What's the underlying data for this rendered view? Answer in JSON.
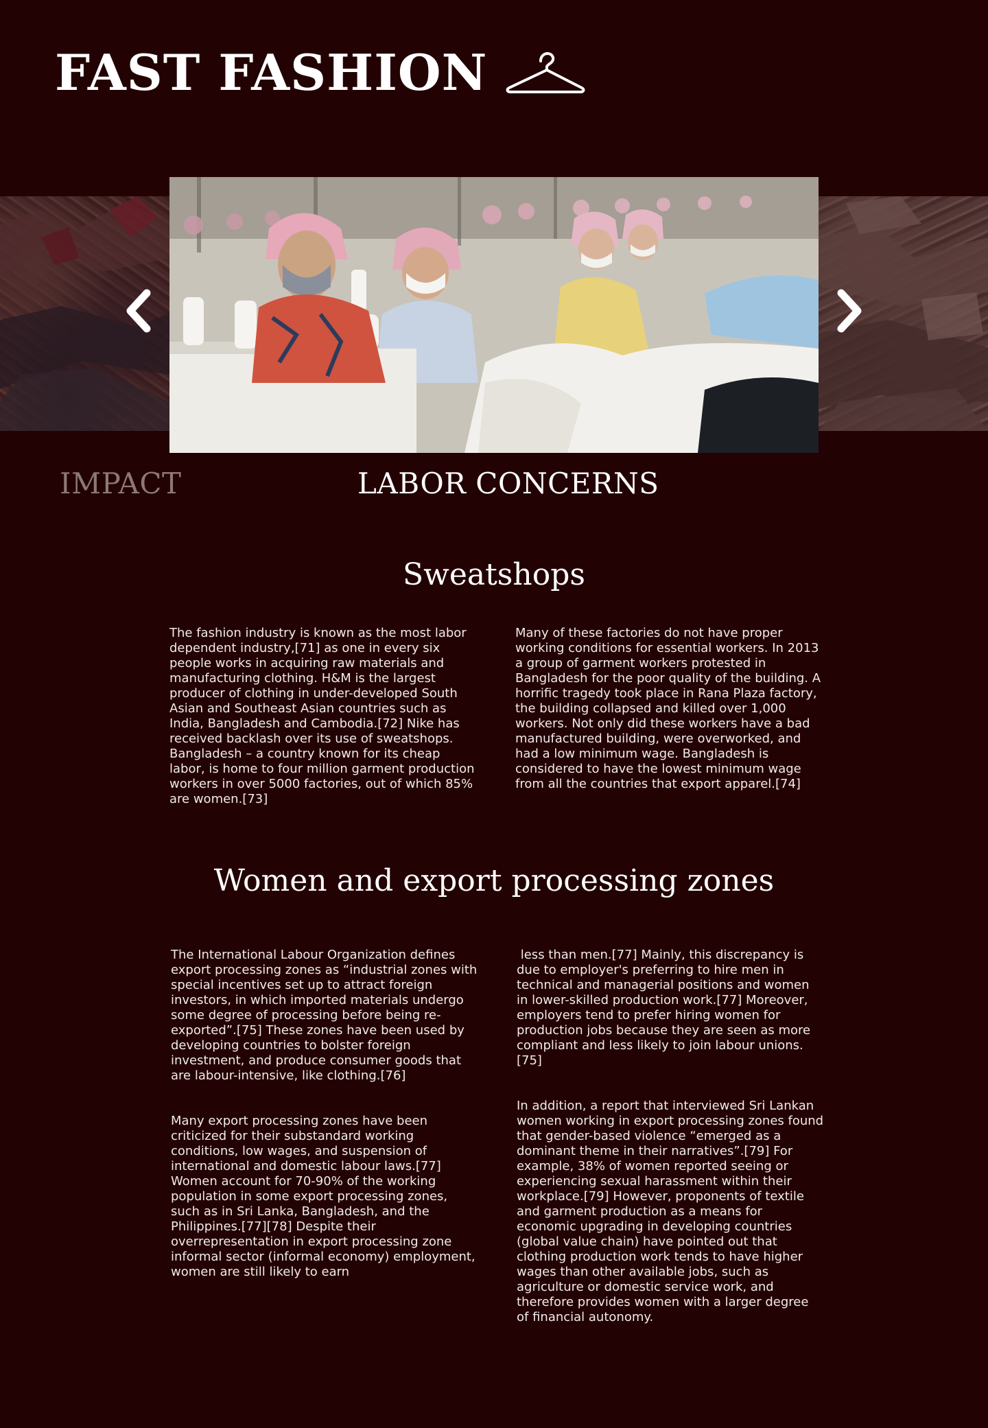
{
  "header": {
    "title": "FAST FASHION",
    "icon": "hanger-icon"
  },
  "carousel": {
    "prev_icon": "chevron-left-icon",
    "next_icon": "chevron-right-icon",
    "slides": {
      "left": "garment-waste-photo",
      "center": "garment-factory-workers-photo",
      "right": "collapsed-building-rubble-photo"
    },
    "labels": {
      "previous": "IMPACT",
      "current": "LABOR CONCERNS"
    }
  },
  "sweatshops": {
    "heading": "Sweatshops",
    "col1": "The fashion industry is known as the most labor dependent industry,[71] as one in every six people works in acquiring raw materials and manufacturing clothing. H&M is the largest producer of clothing in under-developed South Asian and Southeast Asian countries such as India, Bangladesh and Cambodia.[72] Nike has received backlash over its use of sweatshops. Bangladesh – a country known for its cheap labor, is home to four million garment production workers in over 5000 factories, out of which 85% are women.[73]",
    "col2": "Many of these factories do not have proper working conditions for essential workers. In 2013 a group of garment workers protested in Bangladesh for the poor quality of the building. A horrific tragedy took place in Rana Plaza factory, the building collapsed and killed over 1,000 workers. Not only did these workers have a bad manufactured building, were overworked, and had a low minimum wage. Bangladesh is considered to have the lowest minimum wage from all the countries that export apparel.[74]"
  },
  "women_epz": {
    "heading": "Women and export processing zones",
    "col1_p1": "The International Labour Organization defines export processing zones as “industrial zones with special incentives set up to attract foreign investors, in which imported materials undergo some degree of processing before being re-exported”.[75] These zones have been used by developing countries to bolster foreign investment, and produce consumer goods that are labour-intensive, like clothing.[76]",
    "col1_p2": "Many export processing zones have been criticized for their substandard working conditions, low wages, and suspension of international and domestic labour laws.[77] Women account for 70-90% of the working population in some export processing zones, such as in Sri Lanka, Bangladesh, and the Philippines.[77][78] Despite their overrepresentation in export processing zone informal sector (informal economy) employment, women are still likely to earn",
    "col2_p1": " less than men.[77] Mainly, this discrepancy is due to employer's preferring to hire men in technical and managerial positions and women in lower-skilled production work.[77] Moreover, employers tend to prefer hiring women for production jobs because they are seen as more compliant and less likely to join labour unions.[75]",
    "col2_p2": "In addition, a report that interviewed Sri Lankan women working in export processing zones found that gender-based violence “emerged as a dominant theme in their narratives”.[79] For example, 38% of women reported seeing or experiencing sexual harassment within their workplace.[79] However, proponents of textile and garment production as a means for economic upgrading in developing countries (global value chain) have pointed out that clothing production work tends to have higher wages than other available jobs, such as agriculture or domestic service work, and therefore provides women with a larger degree of financial autonomy."
  }
}
